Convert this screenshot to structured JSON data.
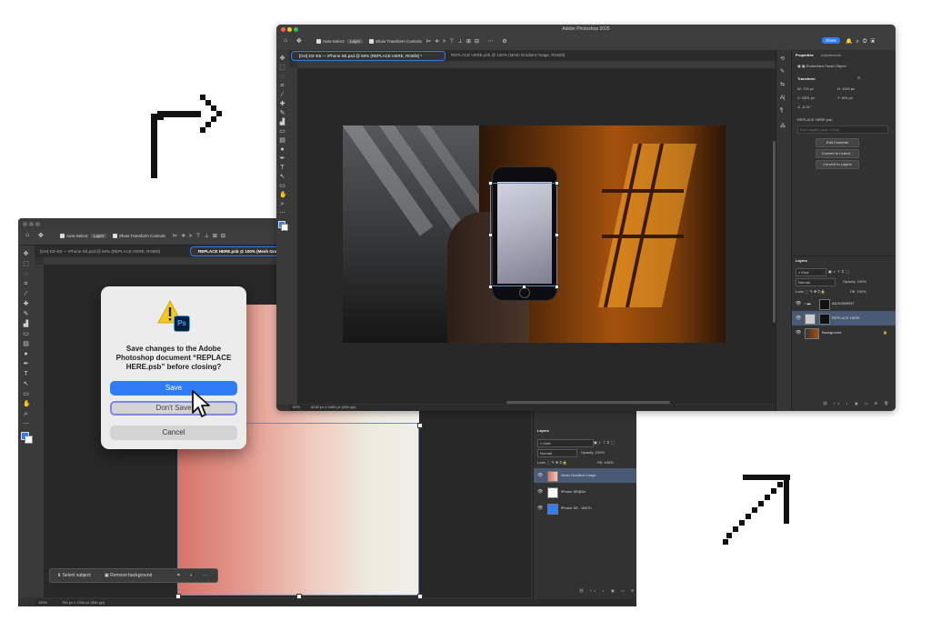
{
  "back_window": {
    "options_bar": {
      "auto_select_label": "Auto-Select:",
      "auto_select_value": "Layer",
      "show_transform_label": "Show Transform Controls"
    },
    "tabs": [
      {
        "label": "[GH] D3–E5 — iPhone SE.psd @ 50% (REPLACE HERE, RGB/8)"
      },
      {
        "label": "REPLACE HERE.psb @ 100% (Mesh Gradient Image"
      }
    ],
    "ruler_ticks": [
      "850",
      "800",
      "750",
      "700",
      "650",
      "600",
      "550",
      "500",
      "450"
    ],
    "status": {
      "zoom": "100%",
      "doc_info": "750 px x 1334 px (350 ppi)"
    },
    "contextual_bar": {
      "select_subject": "Select subject",
      "remove_background": "Remove background"
    },
    "layers_panel": {
      "title": "Layers",
      "kind": "Kind",
      "blend_mode": "Normal",
      "opacity_label": "Opacity:",
      "opacity_value": "100%",
      "lock_label": "Lock:",
      "fill_label": "Fill:",
      "fill_value": "100%",
      "layers": [
        {
          "name": "Mesh Gradient Image",
          "selected": true
        },
        {
          "name": "iPhone SE@2x",
          "selected": false
        },
        {
          "name": "iPhone SE - W&Th",
          "selected": false
        }
      ]
    }
  },
  "front_window": {
    "title": "Adobe Photoshop 2025",
    "options_bar": {
      "auto_select_label": "Auto-Select:",
      "auto_select_value": "Layer",
      "show_transform_label": "Show Transform Controls",
      "share_label": "Share"
    },
    "tabs": [
      {
        "label": "[GH] D3–E5 — iPhone SE.psd @ 50% (REPLACE HERE, RGB/8) *"
      },
      {
        "label": "REPLACE HERE.psb @ 100% (Mesh Gradient Image, RGB/8)"
      }
    ],
    "status": {
      "zoom": "50%",
      "doc_info": "6240 px x 3480 px (350 ppi)"
    },
    "properties_panel": {
      "tab_properties": "Properties",
      "tab_adjustments": "Adjustments",
      "object_type": "Embedded Smart Object",
      "transform_label": "Transform",
      "w_label": "W:",
      "w_value": "715 px",
      "h_label": "H:",
      "h_value": "1169 px",
      "x_label": "X:",
      "x_value": "1591 px",
      "y_label": "Y:",
      "y_value": "619 px",
      "angle_value": "-0.01°",
      "file_name": "REPLACE HERE.psb",
      "layer_comp_placeholder": "Don't Apply Layer Comp",
      "edit_contents": "Edit Contents",
      "convert_to_linked": "Convert to Linked...",
      "convert_to_layers": "Convert to Layers"
    },
    "layers_panel": {
      "title": "Layers",
      "kind": "Kind",
      "blend_mode": "Normal",
      "opacity_label": "Opacity:",
      "opacity_value": "100%",
      "lock_label": "Lock:",
      "fill_label": "Fill:",
      "fill_value": "100%",
      "layers": [
        {
          "name": "ADJUSMENT",
          "selected": false
        },
        {
          "name": "REPLACE HERE",
          "selected": true
        },
        {
          "name": "Background",
          "selected": false
        }
      ]
    }
  },
  "dialog": {
    "message": "Save changes to the Adobe Photoshop document “REPLACE HERE.psb” before closing?",
    "save_label": "Save",
    "dont_save_label": "Don't Save",
    "cancel_label": "Cancel",
    "app_badge": "Ps"
  },
  "colors": {
    "accent_blue": "#2f7cf6",
    "dialog_bg": "#ececec",
    "panel_bg": "#323232",
    "selected_layer": "#4a5a75",
    "warning_yellow": "#f3c623"
  }
}
